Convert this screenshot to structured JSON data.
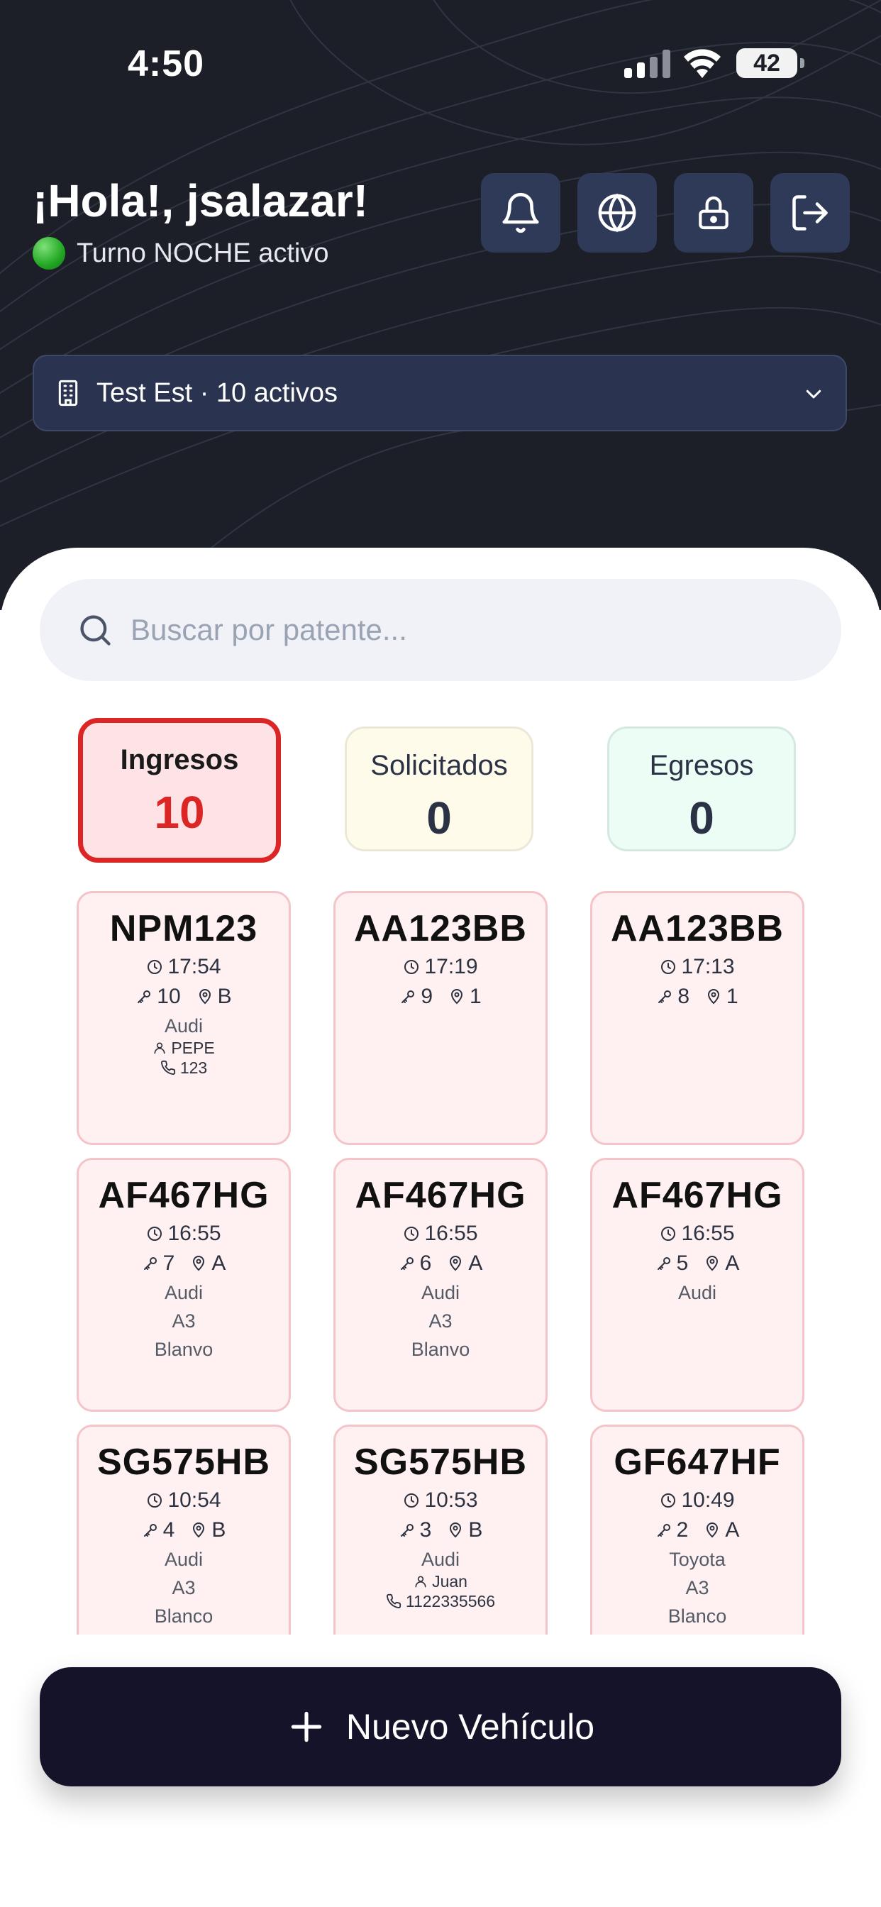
{
  "status_bar": {
    "time": "4:50",
    "battery": "42"
  },
  "header": {
    "greeting": "¡Hola!, jsalazar!",
    "shift": "Turno NOCHE activo",
    "buttons": [
      "bell-icon",
      "globe-icon",
      "lock-icon",
      "logout-icon"
    ]
  },
  "selector": {
    "label": "Test Est · 10 activos"
  },
  "search": {
    "placeholder": "Buscar por patente..."
  },
  "counters": {
    "ingresos": {
      "label": "Ingresos",
      "value": "10"
    },
    "solicitados": {
      "label": "Solicitados",
      "value": "0"
    },
    "egresos": {
      "label": "Egresos",
      "value": "0"
    }
  },
  "cards": [
    {
      "plate": "NPM123",
      "time": "17:54",
      "key": "10",
      "spot": "B",
      "lines": [
        "Audi"
      ],
      "person": "PEPE",
      "phone": "123"
    },
    {
      "plate": "AA123BB",
      "time": "17:19",
      "key": "9",
      "spot": "1",
      "lines": []
    },
    {
      "plate": "AA123BB",
      "time": "17:13",
      "key": "8",
      "spot": "1",
      "lines": []
    },
    {
      "plate": "AF467HG",
      "time": "16:55",
      "key": "7",
      "spot": "A",
      "lines": [
        "Audi",
        "A3",
        "Blanvo"
      ]
    },
    {
      "plate": "AF467HG",
      "time": "16:55",
      "key": "6",
      "spot": "A",
      "lines": [
        "Audi",
        "A3",
        "Blanvo"
      ]
    },
    {
      "plate": "AF467HG",
      "time": "16:55",
      "key": "5",
      "spot": "A",
      "lines": [
        "Audi"
      ]
    },
    {
      "plate": "SG575HB",
      "time": "10:54",
      "key": "4",
      "spot": "B",
      "lines": [
        "Audi",
        "A3",
        "Blanco"
      ]
    },
    {
      "plate": "SG575HB",
      "time": "10:53",
      "key": "3",
      "spot": "B",
      "lines": [
        "Audi"
      ],
      "person": "Juan",
      "phone": "1122335566"
    },
    {
      "plate": "GF647HF",
      "time": "10:49",
      "key": "2",
      "spot": "A",
      "lines": [
        "Toyota",
        "A3",
        "Blanco"
      ]
    }
  ],
  "fab": {
    "label": "Nuevo Vehículo"
  },
  "colors": {
    "header_bg": "#1c1f28",
    "accent_red": "#dc2626",
    "card_bg": "#fff1f2",
    "fab_bg": "#15132a"
  }
}
